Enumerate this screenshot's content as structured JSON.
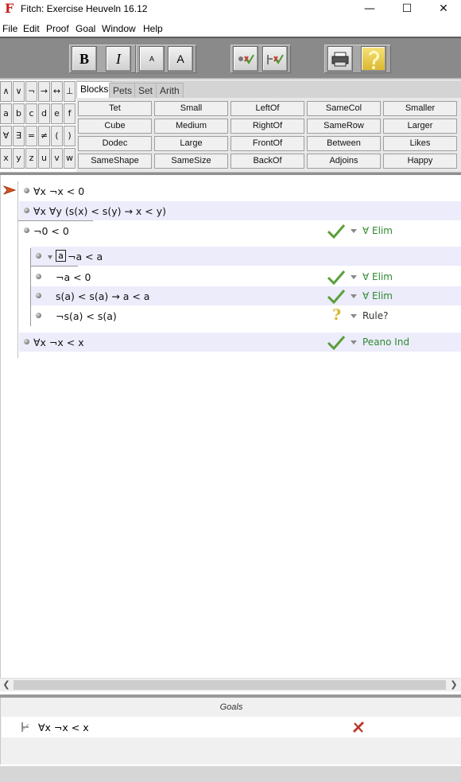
{
  "window": {
    "title": "Fitch: Exercise Heuveln 16.12",
    "app_icon": "F",
    "controls": {
      "minimize": "—",
      "maximize": "☐",
      "close": "✕"
    }
  },
  "menu": [
    "File",
    "Edit",
    "Proof",
    "Goal",
    "Window",
    "Help"
  ],
  "toolbar": {
    "bold": "B",
    "italic": "I",
    "font_small": "A",
    "font_large": "A",
    "icons": [
      "verify-icon",
      "verify-all-icon",
      "print-icon",
      "help-icon"
    ]
  },
  "symbols": [
    [
      "∧",
      "∨",
      "¬",
      "→",
      "↔",
      "⊥"
    ],
    [
      "a",
      "b",
      "c",
      "d",
      "e",
      "f"
    ],
    [
      "∀",
      "∃",
      "=",
      "≠",
      "(",
      ")"
    ],
    [
      "x",
      "y",
      "z",
      "u",
      "v",
      "w"
    ]
  ],
  "tabs": [
    "Blocks",
    "Pets",
    "Set",
    "Arith"
  ],
  "active_tab": "Blocks",
  "predicates": [
    [
      "Tet",
      "Small",
      "LeftOf",
      "SameCol",
      "Smaller"
    ],
    [
      "Cube",
      "Medium",
      "RightOf",
      "SameRow",
      "Larger"
    ],
    [
      "Dodec",
      "Large",
      "FrontOf",
      "Between",
      "Likes"
    ],
    [
      "SameShape",
      "SameSize",
      "BackOf",
      "Adjoins",
      "Happy"
    ]
  ],
  "proof": {
    "premises": [
      {
        "formula": "∀x ¬x < 0"
      },
      {
        "formula": "∀x ∀y (s(x) < s(y) → x < y)"
      }
    ],
    "steps": [
      {
        "formula": "¬0 < 0",
        "status": "ok",
        "rule": "∀ Elim"
      }
    ],
    "subproof": {
      "boxed_constant": "a",
      "assumption": "¬a < a",
      "steps": [
        {
          "formula": "¬a < 0",
          "status": "ok",
          "rule": "∀ Elim"
        },
        {
          "formula": "s(a) < s(a) → a < a",
          "status": "ok",
          "rule": "∀ Elim"
        },
        {
          "formula": "¬s(a) < s(a)",
          "status": "pending",
          "rule": "Rule?"
        }
      ]
    },
    "conclusion": {
      "formula": "∀x ¬x < x",
      "status": "ok",
      "rule": "Peano Ind"
    }
  },
  "goals": {
    "header": "Goals",
    "items": [
      {
        "formula": "∀x ¬x < x",
        "status": "unsatisfied"
      }
    ]
  },
  "colors": {
    "ok_rule": "#2f8a2f",
    "check": "#5a9e3a",
    "question": "#d7b62a",
    "fail_cross": "#c0392b",
    "shaded_row": "#ececfb"
  }
}
